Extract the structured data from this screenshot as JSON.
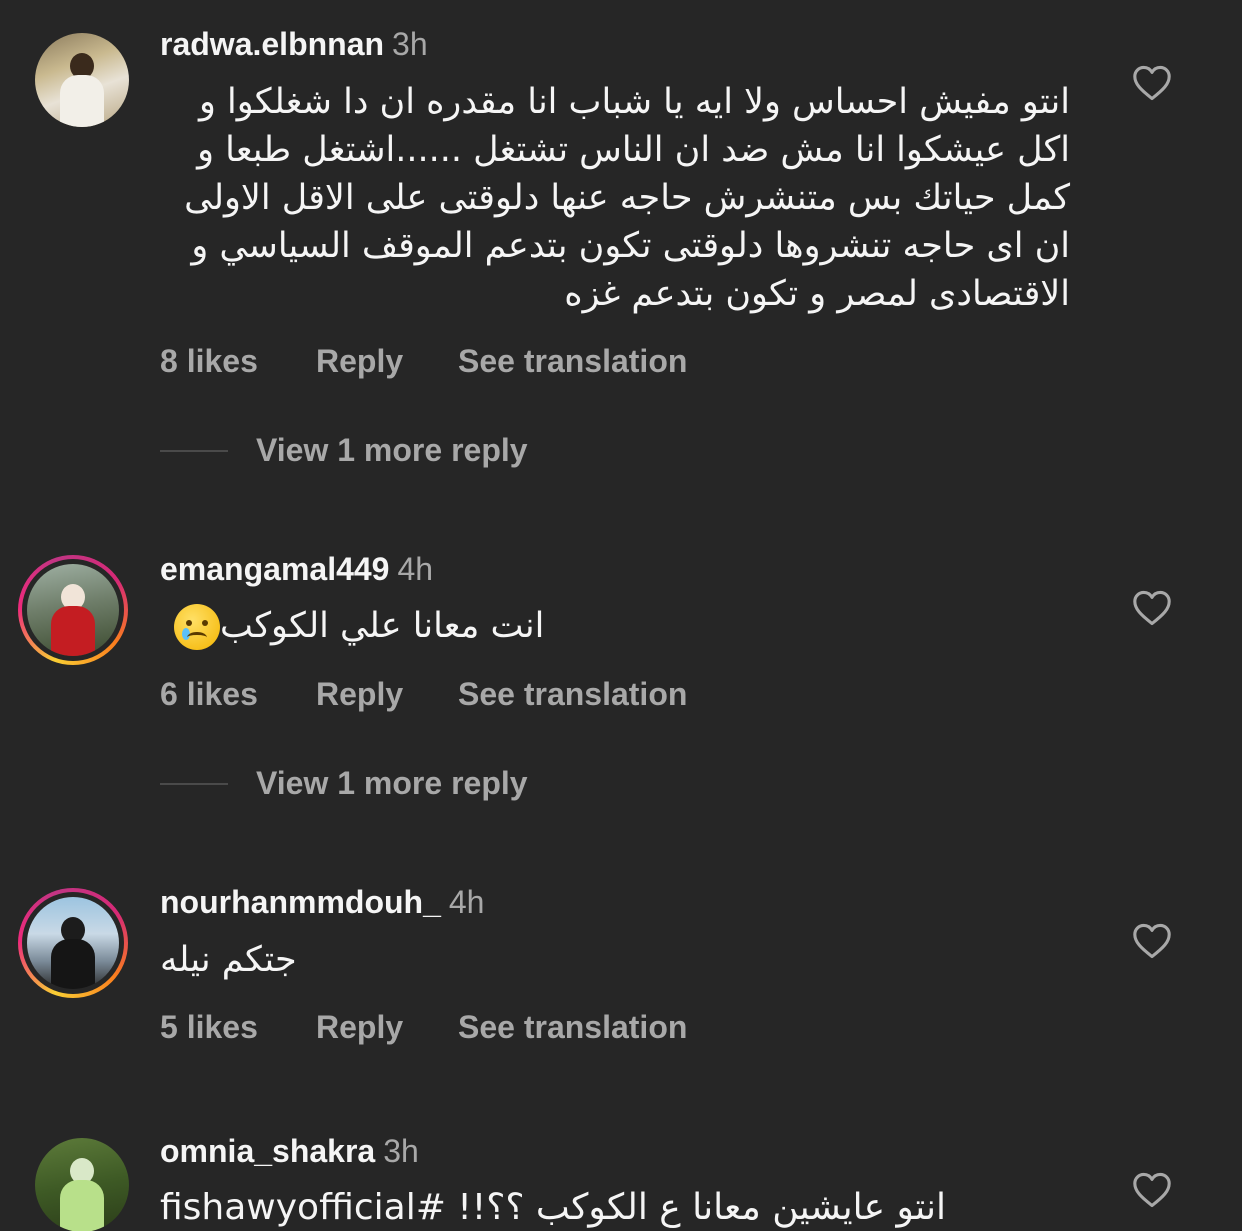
{
  "comments": [
    {
      "username": "radwa.elbnnan",
      "time": "3h",
      "lines": [
        "انتو مفيش احساس ولا ايه يا شباب  انا مقدره ان دا شغلكوا و",
        "اكل عيشكوا  انا مش ضد ان الناس تشتغل ......اشتغل طبعا و",
        "كمل حياتك بس متنشرش حاجه عنها دلوقتى على الاقل الاولى",
        "ان اى حاجه تنشروها دلوقتى  تكون بتدعم الموقف السياسي و",
        "الاقتصادى لمصر و تكون بتدعم غزه"
      ],
      "likes": "8 likes",
      "reply": "Reply",
      "translate": "See translation",
      "view_more": "View 1 more reply",
      "avatar_icon": "profile-photo"
    },
    {
      "username": "emangamal449",
      "time": "4h",
      "text": "انت معانا علي الكوكب",
      "emoji": "crying-face",
      "likes": "6 likes",
      "reply": "Reply",
      "translate": "See translation",
      "view_more": "View 1 more reply",
      "avatar_icon": "profile-photo-story-ring"
    },
    {
      "username": "nourhanmmdouh_",
      "time": "4h",
      "text": "جتكم نيله",
      "likes": "5 likes",
      "reply": "Reply",
      "translate": "See translation",
      "avatar_icon": "profile-photo-story-ring"
    },
    {
      "username": "omnia_shakra",
      "time": "3h",
      "text": "انتو عايشين معانا ع الكوكب ؟؟!! #fishawyofficial",
      "avatar_icon": "profile-photo"
    }
  ],
  "icons": {
    "like": "heart-outline-icon"
  },
  "colors": {
    "background": "#262626",
    "primary_text": "#f5f5f5",
    "secondary_text": "#a8a8a8"
  }
}
